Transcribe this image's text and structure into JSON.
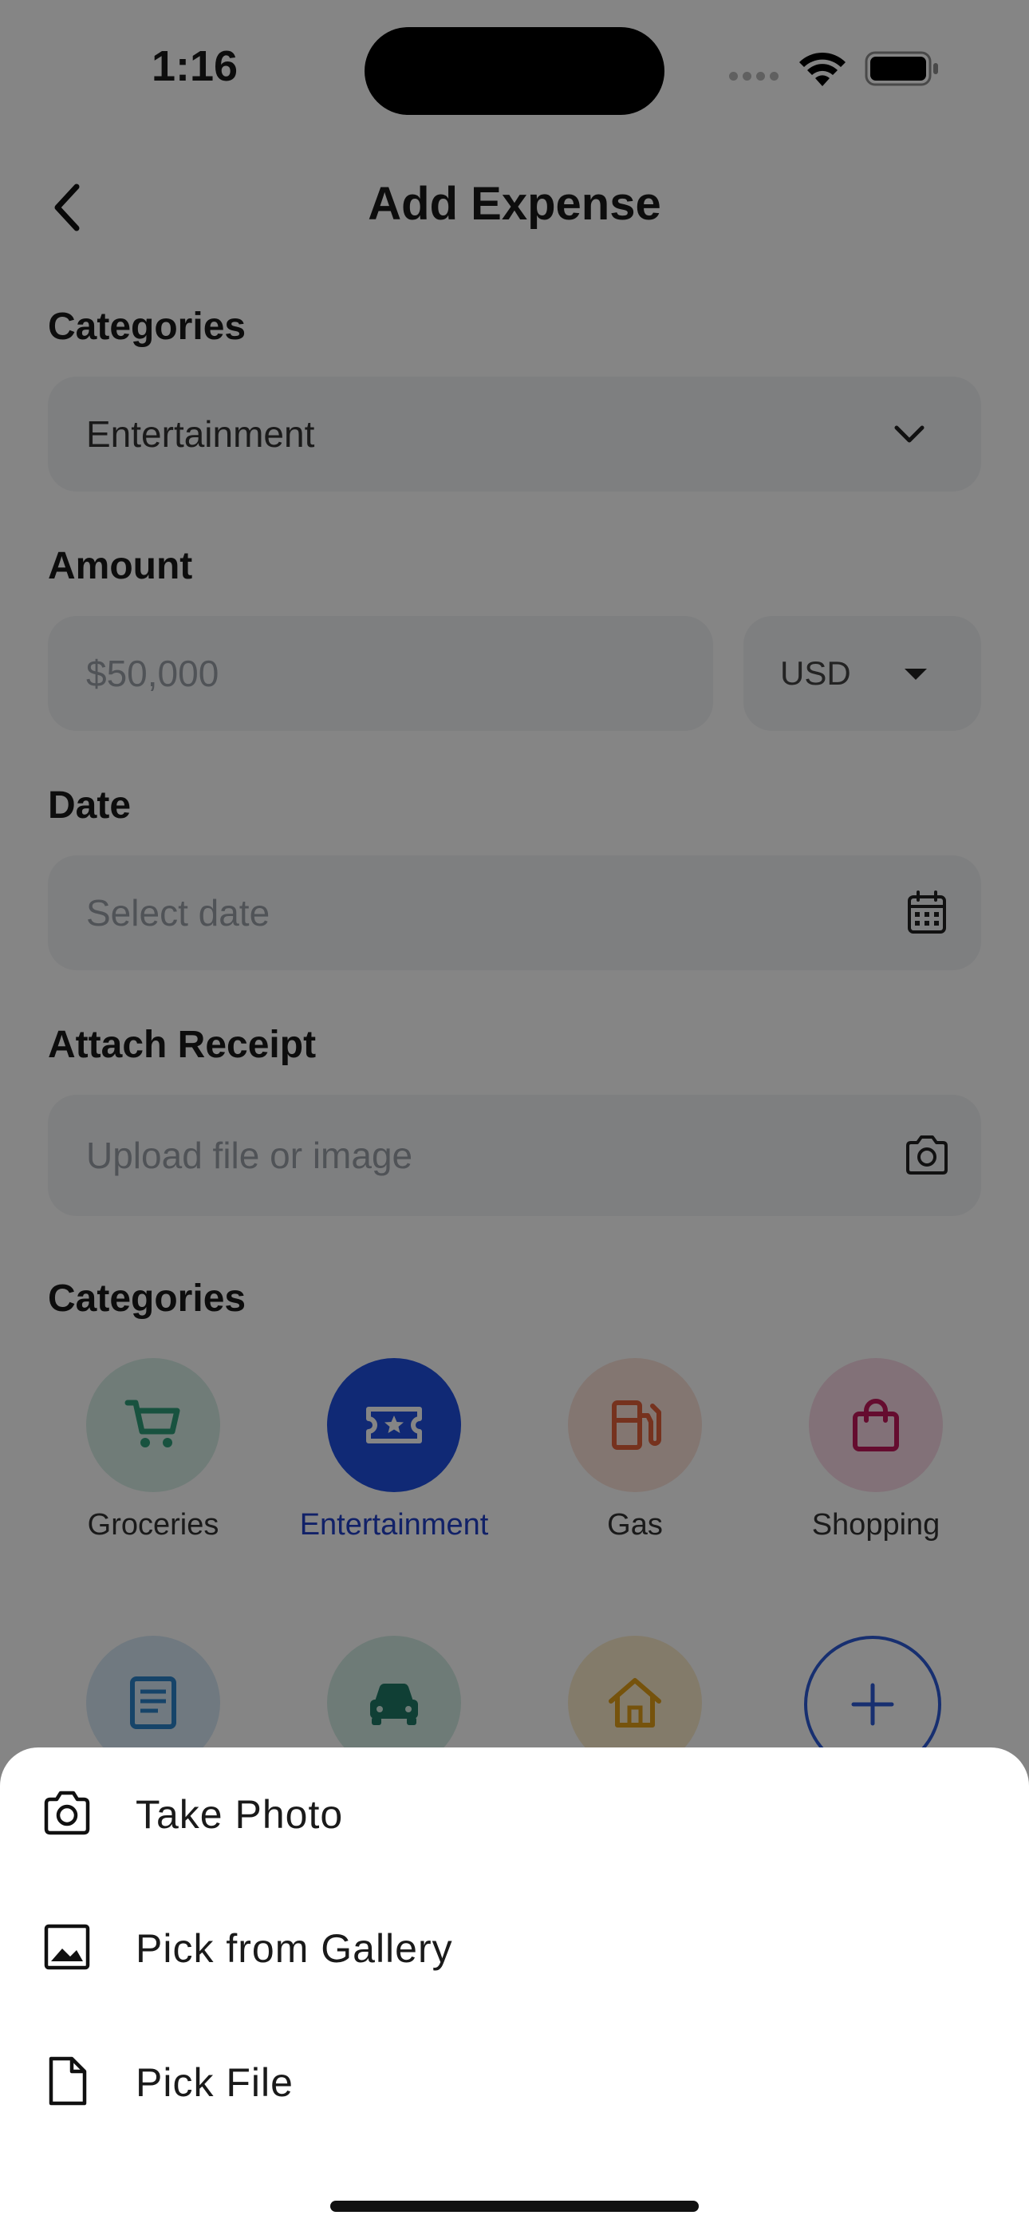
{
  "status_bar": {
    "time": "1:16"
  },
  "header": {
    "title": "Add Expense"
  },
  "form": {
    "category_label": "Categories",
    "category_value": "Entertainment",
    "amount_label": "Amount",
    "amount_placeholder": "$50,000",
    "currency": "USD",
    "date_label": "Date",
    "date_placeholder": "Select date",
    "receipt_label": "Attach Receipt",
    "receipt_placeholder": "Upload file or image"
  },
  "categories": {
    "title": "Categories",
    "items": [
      {
        "label": "Groceries",
        "icon": "cart-icon",
        "color": "#2e9e7a",
        "bg": "#d6eee6"
      },
      {
        "label": "Entertainment",
        "icon": "ticket-icon",
        "color": "#ffffff",
        "bg": "#1f4fe0",
        "selected": true
      },
      {
        "label": "Gas",
        "icon": "fuel-icon",
        "color": "#e2603a",
        "bg": "#fbe2d9"
      },
      {
        "label": "Shopping",
        "icon": "bag-icon",
        "color": "#c2185b",
        "bg": "#f9d9e6"
      }
    ],
    "row2_icons": [
      {
        "icon": "document-icon",
        "color": "#2b83c9",
        "bg": "#d6e8f6"
      },
      {
        "icon": "car-icon",
        "color": "#1f7a66",
        "bg": "#d3ece4"
      },
      {
        "icon": "home-icon",
        "color": "#e3a017",
        "bg": "#fbeccc"
      },
      {
        "icon": "add-icon",
        "color": "#2d5bd6",
        "bg": "transparent"
      }
    ],
    "accent": "#2140c8"
  },
  "sheet": {
    "options": [
      {
        "label": "Take Photo",
        "icon": "camera-icon"
      },
      {
        "label": "Pick from Gallery",
        "icon": "image-icon"
      },
      {
        "label": "Pick File",
        "icon": "file-icon"
      }
    ]
  }
}
